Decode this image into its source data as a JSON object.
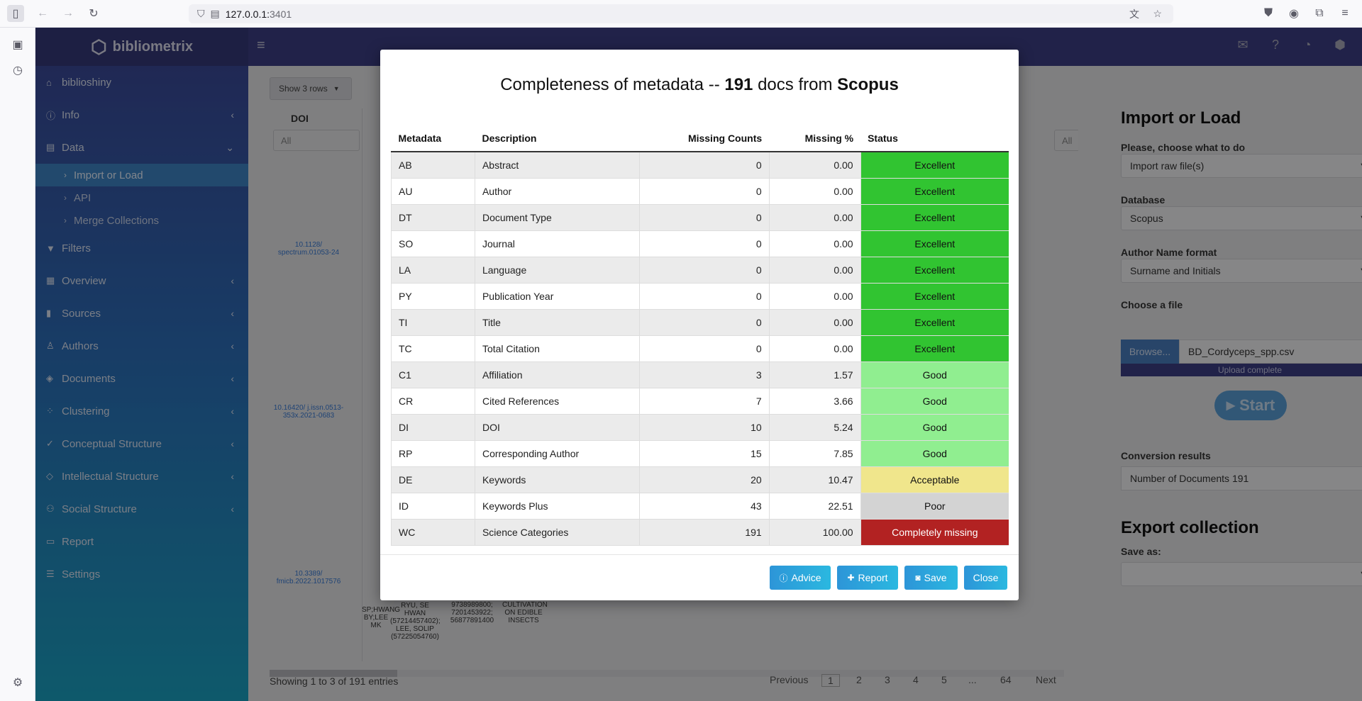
{
  "browser": {
    "url_host": "127.0.0.1:",
    "url_port": "3401"
  },
  "app": {
    "logo": "bibliometrix"
  },
  "sidebar": {
    "items": [
      {
        "label": "biblioshiny",
        "icon": "home-icon"
      },
      {
        "label": "Info",
        "icon": "info-icon"
      },
      {
        "label": "Data",
        "icon": "file-icon"
      },
      {
        "label": "Filters",
        "icon": "filter-icon"
      },
      {
        "label": "Overview",
        "icon": "table-icon"
      },
      {
        "label": "Sources",
        "icon": "book-icon"
      },
      {
        "label": "Authors",
        "icon": "user-icon"
      },
      {
        "label": "Documents",
        "icon": "layers-icon"
      },
      {
        "label": "Clustering",
        "icon": "spinner-icon"
      },
      {
        "label": "Conceptual Structure",
        "icon": "spell-check-icon"
      },
      {
        "label": "Intellectual Structure",
        "icon": "gem-icon"
      },
      {
        "label": "Social Structure",
        "icon": "users-icon"
      },
      {
        "label": "Report",
        "icon": "report-icon"
      },
      {
        "label": "Settings",
        "icon": "sliders-icon"
      }
    ],
    "data_sub": [
      "Import or Load",
      "API",
      "Merge Collections"
    ]
  },
  "background": {
    "show_rows": "Show 3 rows",
    "col_doi": "DOI",
    "filter_all": "All",
    "doi1": "10.1128/ spectrum.01053-24",
    "doi2": "10.16420/ j.issn.0513-353x.2021-0683",
    "doi3": "10.3389/ fmicb.2022.1017576",
    "frag1": "RYU, SE HWAN (57214457402); LEE, SOLIP (57225054760)",
    "frag2": "9738989800; 7201453922; 56877891400",
    "frag3": "CULTIVATION ON EDIBLE INSECTS",
    "frag4": "SP;HWANG BY;LEE MK",
    "footer": "Showing 1 to 3 of 191 entries",
    "pager": [
      "Previous",
      "1",
      "2",
      "3",
      "4",
      "5",
      "...",
      "64",
      "Next"
    ]
  },
  "right_panel": {
    "title": "Import or Load",
    "choose_label": "Please, choose what to do",
    "choose_value": "Import raw file(s)",
    "database_label": "Database",
    "database_value": "Scopus",
    "author_format_label": "Author Name format",
    "author_format_value": "Surname and Initials",
    "file_label": "Choose a file",
    "browse": "Browse...",
    "filename": "BD_Cordyceps_spp.csv",
    "upload_status": "Upload complete",
    "start": "Start",
    "conversion_label": "Conversion results",
    "conversion_value": "Number of Documents  191",
    "export_title": "Export collection",
    "save_as_label": "Save as:"
  },
  "modal": {
    "title_prefix": "Completeness of metadata -- ",
    "title_count": "191",
    "title_mid": " docs from ",
    "title_source": "Scopus",
    "headers": [
      "Metadata",
      "Description",
      "Missing Counts",
      "Missing %",
      "Status"
    ],
    "rows": [
      {
        "tag": "AB",
        "desc": "Abstract",
        "count": "0",
        "pct": "0.00",
        "status": "Excellent",
        "cls": "exc"
      },
      {
        "tag": "AU",
        "desc": "Author",
        "count": "0",
        "pct": "0.00",
        "status": "Excellent",
        "cls": "exc"
      },
      {
        "tag": "DT",
        "desc": "Document Type",
        "count": "0",
        "pct": "0.00",
        "status": "Excellent",
        "cls": "exc"
      },
      {
        "tag": "SO",
        "desc": "Journal",
        "count": "0",
        "pct": "0.00",
        "status": "Excellent",
        "cls": "exc"
      },
      {
        "tag": "LA",
        "desc": "Language",
        "count": "0",
        "pct": "0.00",
        "status": "Excellent",
        "cls": "exc"
      },
      {
        "tag": "PY",
        "desc": "Publication Year",
        "count": "0",
        "pct": "0.00",
        "status": "Excellent",
        "cls": "exc"
      },
      {
        "tag": "TI",
        "desc": "Title",
        "count": "0",
        "pct": "0.00",
        "status": "Excellent",
        "cls": "exc"
      },
      {
        "tag": "TC",
        "desc": "Total Citation",
        "count": "0",
        "pct": "0.00",
        "status": "Excellent",
        "cls": "exc"
      },
      {
        "tag": "C1",
        "desc": "Affiliation",
        "count": "3",
        "pct": "1.57",
        "status": "Good",
        "cls": "good"
      },
      {
        "tag": "CR",
        "desc": "Cited References",
        "count": "7",
        "pct": "3.66",
        "status": "Good",
        "cls": "good"
      },
      {
        "tag": "DI",
        "desc": "DOI",
        "count": "10",
        "pct": "5.24",
        "status": "Good",
        "cls": "good"
      },
      {
        "tag": "RP",
        "desc": "Corresponding Author",
        "count": "15",
        "pct": "7.85",
        "status": "Good",
        "cls": "good"
      },
      {
        "tag": "DE",
        "desc": "Keywords",
        "count": "20",
        "pct": "10.47",
        "status": "Acceptable",
        "cls": "acc"
      },
      {
        "tag": "ID",
        "desc": "Keywords Plus",
        "count": "43",
        "pct": "22.51",
        "status": "Poor",
        "cls": "poor"
      },
      {
        "tag": "WC",
        "desc": "Science Categories",
        "count": "191",
        "pct": "100.00",
        "status": "Completely missing",
        "cls": "miss"
      }
    ],
    "buttons": {
      "advice": "Advice",
      "report": "Report",
      "save": "Save",
      "close": "Close"
    }
  },
  "colors": {
    "excellent": "#31c431",
    "good": "#90ee90",
    "acceptable": "#f0e68c",
    "poor": "#d3d3d3",
    "missing": "#b22222",
    "header": "#3c3f86"
  }
}
